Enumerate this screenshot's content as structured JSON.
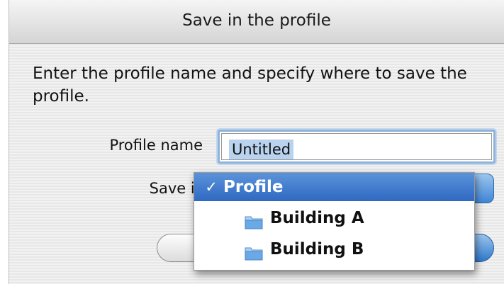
{
  "dialog": {
    "title": "Save in the profile",
    "instructions": "Enter the profile name and specify where to save the profile."
  },
  "form": {
    "profile_name_label": "Profile name",
    "profile_name_value": "Untitled",
    "save_in_label": "Save in"
  },
  "menu": {
    "items": [
      {
        "label": "Profile",
        "selected": true,
        "check": "✓",
        "icon": ""
      },
      {
        "label": "Building A",
        "selected": false,
        "check": "",
        "icon": "folder-icon"
      },
      {
        "label": "Building B",
        "selected": false,
        "check": "",
        "icon": "folder-icon"
      }
    ]
  },
  "colors": {
    "selection": "#3a75cc",
    "focus_ring": "#8fb3d9",
    "folder": "#6aa9e6"
  }
}
